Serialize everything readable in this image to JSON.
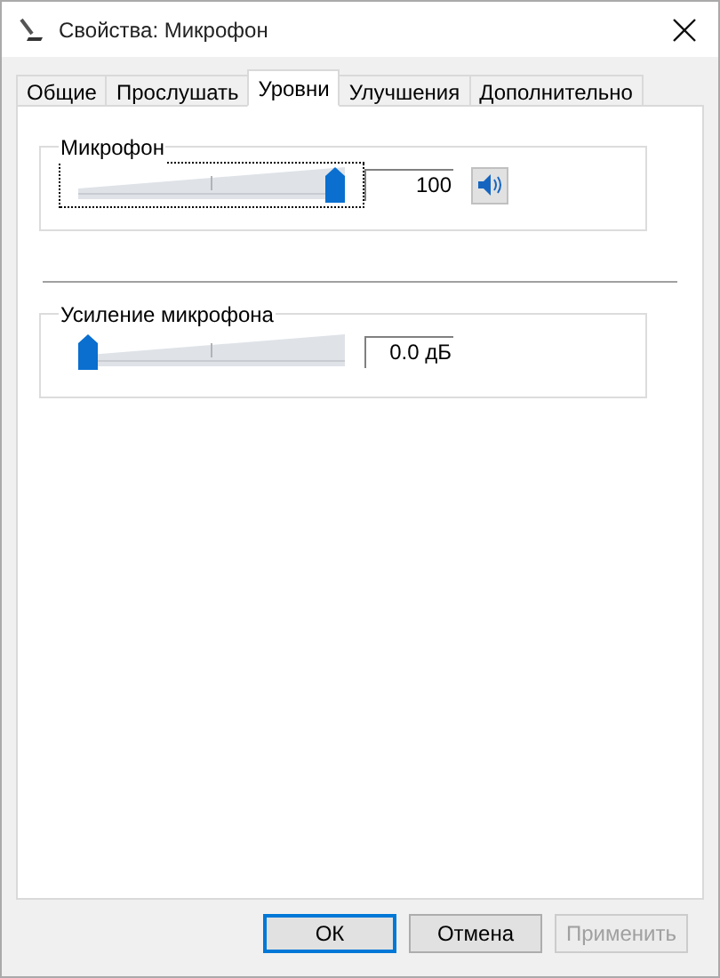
{
  "window": {
    "title": "Свойства: Микрофон"
  },
  "tabs": [
    {
      "label": "Общие",
      "selected": false
    },
    {
      "label": "Прослушать",
      "selected": false
    },
    {
      "label": "Уровни",
      "selected": true
    },
    {
      "label": "Улучшения",
      "selected": false
    },
    {
      "label": "Дополнительно",
      "selected": false
    }
  ],
  "levels": [
    {
      "name": "Микрофон",
      "level": 1,
      "reading": "100",
      "focused": true,
      "mute_button": true
    },
    {
      "name": "Усиление микрофона",
      "level": 0,
      "reading": "0.0 дБ",
      "focused": false,
      "mute_button": false
    }
  ],
  "buttons": [
    {
      "label": "ОК",
      "default": true,
      "disabled": false
    },
    {
      "label": "Отмена",
      "default": false,
      "disabled": false
    },
    {
      "label": "Применить",
      "default": false,
      "disabled": true
    }
  ]
}
